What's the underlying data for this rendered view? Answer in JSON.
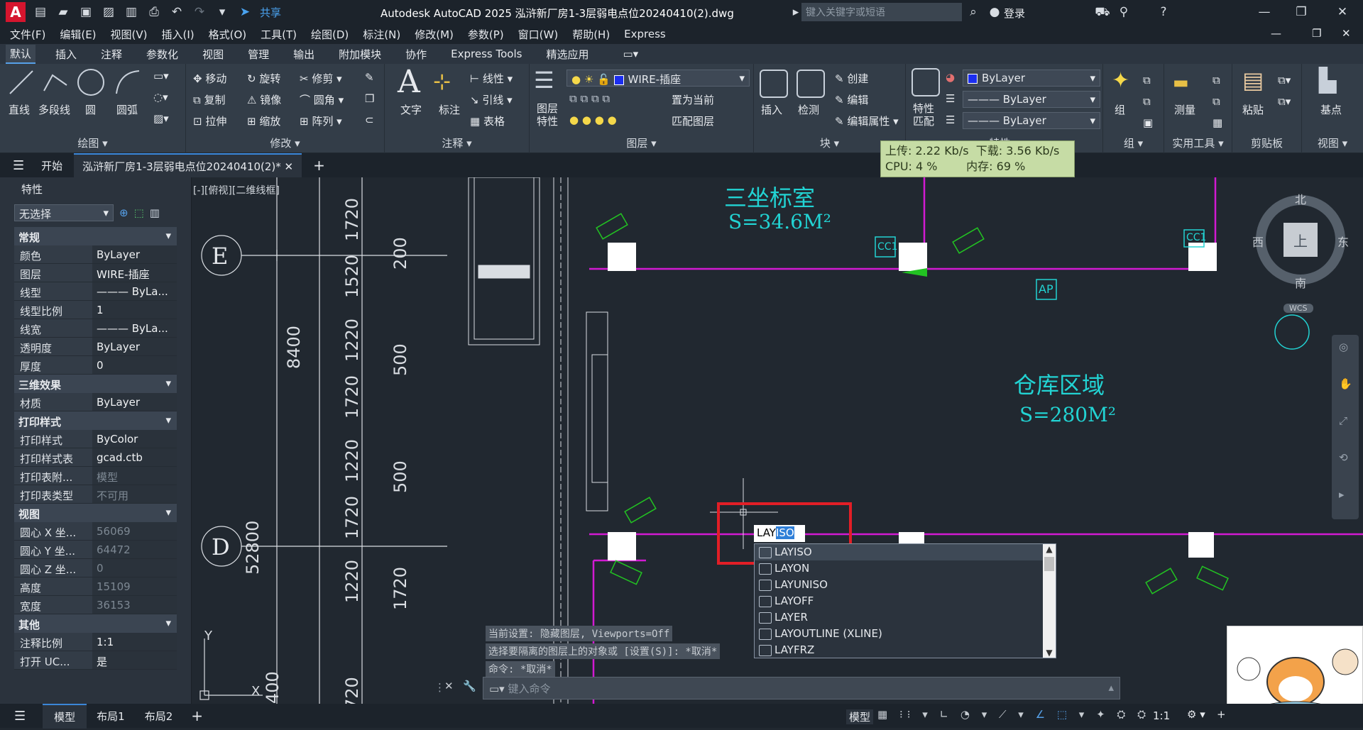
{
  "title_bar": {
    "app_logo": "A",
    "share": "共享",
    "title": "Autodesk AutoCAD 2025    泓浒新厂房1-3层弱电点位20240410(2).dwg",
    "search_placeholder": "键入关键字或短语",
    "login": "登录"
  },
  "menu": [
    "文件(F)",
    "编辑(E)",
    "视图(V)",
    "插入(I)",
    "格式(O)",
    "工具(T)",
    "绘图(D)",
    "标注(N)",
    "修改(M)",
    "参数(P)",
    "窗口(W)",
    "帮助(H)",
    "Express"
  ],
  "ribbon_tabs": [
    "默认",
    "插入",
    "注释",
    "参数化",
    "视图",
    "管理",
    "输出",
    "附加模块",
    "协作",
    "Express Tools",
    "精选应用"
  ],
  "ribbon": {
    "draw": {
      "title": "绘图 ▾",
      "items": [
        "直线",
        "多段线",
        "圆",
        "圆弧"
      ]
    },
    "modify": {
      "title": "修改 ▾",
      "items": [
        "移动",
        "旋转",
        "修剪",
        "复制",
        "镜像",
        "圆角",
        "拉伸",
        "缩放",
        "阵列"
      ]
    },
    "annotation": {
      "title": "注释 ▾",
      "items": [
        "文字",
        "标注",
        "线性",
        "引线",
        "表格"
      ]
    },
    "layers": {
      "title": "图层 ▾",
      "big": "图层\n特性",
      "current": "WIRE-插座",
      "set_current": "置为当前",
      "match": "匹配图层"
    },
    "block": {
      "title": "块 ▾",
      "insert": "插入",
      "inspect": "检测",
      "create": "创建",
      "edit": "编辑",
      "edit_attr": "编辑属性"
    },
    "properties": {
      "title": "特性 ▾",
      "match": "特性\n匹配",
      "color": "ByLayer",
      "linetype": "ByLayer",
      "lineweight": "ByLayer"
    },
    "groups": {
      "title": "组 ▾",
      "group": "组"
    },
    "utilities": {
      "title": "实用工具 ▾",
      "measure": "测量"
    },
    "clipboard": {
      "title": "剪贴板",
      "paste": "粘贴"
    },
    "view": {
      "title": "视图 ▾",
      "base": "基点"
    }
  },
  "doc_tabs": {
    "start": "开始",
    "file": "泓浒新厂房1-3层弱电点位20240410(2)*"
  },
  "net_widget": {
    "upload": "上传: 2.22 Kb/s",
    "download": "下载: 3.56 Kb/s",
    "cpu": "CPU: 4 %",
    "mem": "内存: 69 %"
  },
  "properties": {
    "header": "特性",
    "selector": "无选择",
    "sections": [
      {
        "name": "常规",
        "rows": [
          [
            "颜色",
            "ByLayer"
          ],
          [
            "图层",
            "WIRE-插座"
          ],
          [
            "线型",
            "——— ByLa..."
          ],
          [
            "线型比例",
            "1"
          ],
          [
            "线宽",
            "——— ByLa..."
          ],
          [
            "透明度",
            "ByLayer"
          ],
          [
            "厚度",
            "0"
          ]
        ]
      },
      {
        "name": "三维效果",
        "rows": [
          [
            "材质",
            "ByLayer"
          ]
        ]
      },
      {
        "name": "打印样式",
        "rows": [
          [
            "打印样式",
            "ByColor"
          ],
          [
            "打印样式表",
            "gcad.ctb"
          ],
          [
            "打印表附...",
            "模型"
          ],
          [
            "打印表类型",
            "不可用"
          ]
        ]
      },
      {
        "name": "视图",
        "rows": [
          [
            "圆心 X 坐...",
            "56069"
          ],
          [
            "圆心 Y 坐...",
            "64472"
          ],
          [
            "圆心 Z 坐...",
            "0"
          ],
          [
            "高度",
            "15109"
          ],
          [
            "宽度",
            "36153"
          ]
        ]
      },
      {
        "name": "其他",
        "rows": [
          [
            "注释比例",
            "1:1"
          ],
          [
            "打开 UC...",
            "是"
          ]
        ]
      }
    ]
  },
  "canvas": {
    "viewport_label": "[-][俯视][二维线框]",
    "rooms": [
      {
        "name": "三坐标室",
        "area": "S=34.6M²"
      },
      {
        "name": "仓库区域",
        "area": "S=280M²"
      }
    ],
    "axis_labels": [
      "E",
      "D"
    ],
    "dims": [
      "1720",
      "200",
      "1520",
      "1220",
      "500",
      "1720",
      "1220",
      "500",
      "1720",
      "1720",
      "1220",
      "500",
      "720",
      "400"
    ],
    "big_dims": [
      "8400",
      "52800"
    ],
    "tags": [
      "CC1",
      "CC1",
      "AP"
    ],
    "compass": {
      "n": "北",
      "s": "南",
      "w": "西",
      "e": "东",
      "top": "上",
      "wcs": "WCS"
    },
    "ucs": {
      "y": "Y",
      "x": "X"
    }
  },
  "command": {
    "history": [
      "当前设置: 隐藏图层, Viewports=Off",
      "选择要隔离的图层上的对象或 [设置(S)]: *取消*",
      "命令: *取消*"
    ],
    "input_typed": "LAY",
    "input_suggest": "ISO",
    "placeholder": "键入命令",
    "suggestions": [
      "LAYISO",
      "LAYON",
      "LAYUNISO",
      "LAYOFF",
      "LAYER",
      "LAYOUTLINE (XLINE)",
      "LAYFRZ"
    ]
  },
  "status": {
    "tabs": [
      "模型",
      "布局1",
      "布局2"
    ],
    "right_model": "模型",
    "scale": "1:1"
  }
}
